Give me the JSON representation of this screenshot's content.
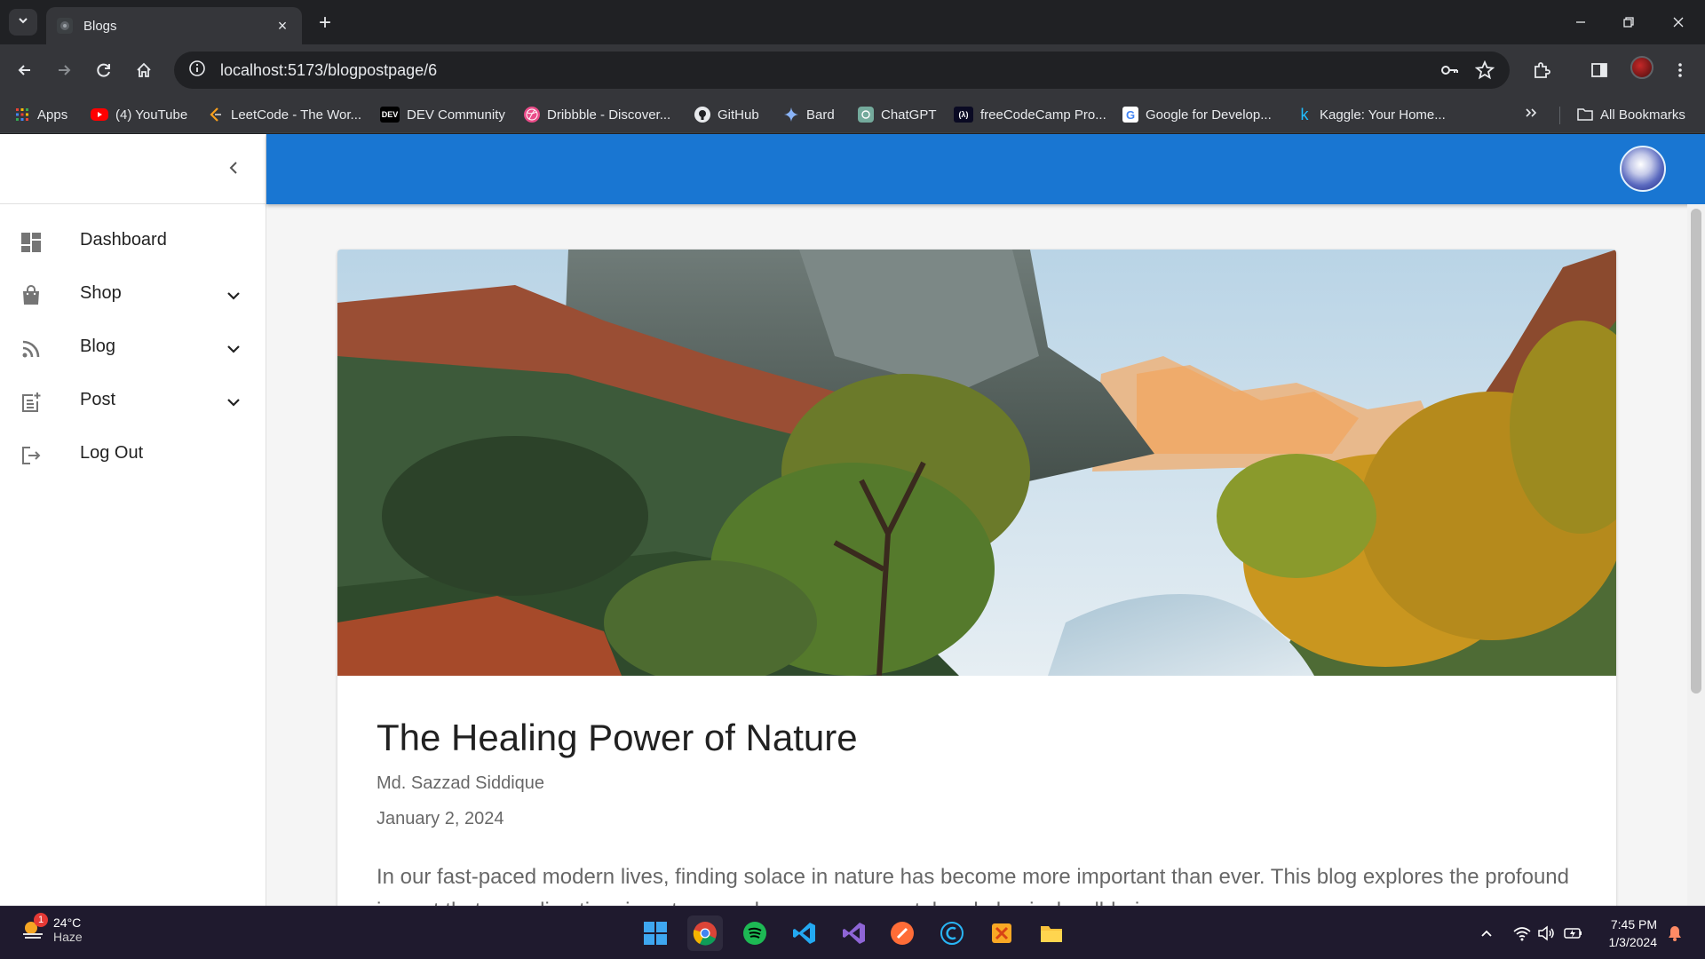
{
  "browser": {
    "tab_title": "Blogs",
    "url": "localhost:5173/blogpostpage/6",
    "bookmarks": [
      {
        "label": "Apps",
        "icon": "apps-grid-icon"
      },
      {
        "label": "(4) YouTube",
        "icon": "youtube-icon"
      },
      {
        "label": "LeetCode - The Wor...",
        "icon": "leetcode-icon"
      },
      {
        "label": "DEV Community",
        "icon": "dev-icon"
      },
      {
        "label": "Dribbble - Discover...",
        "icon": "dribbble-icon"
      },
      {
        "label": "GitHub",
        "icon": "github-icon"
      },
      {
        "label": "Bard",
        "icon": "bard-icon"
      },
      {
        "label": "ChatGPT",
        "icon": "chatgpt-icon"
      },
      {
        "label": "freeCodeCamp Pro...",
        "icon": "freecodecamp-icon"
      },
      {
        "label": "Google for Develop...",
        "icon": "google-icon"
      },
      {
        "label": "Kaggle: Your Home...",
        "icon": "kaggle-icon"
      }
    ],
    "all_bookmarks_label": "All Bookmarks",
    "dev_badge": "DEV",
    "fcc_badge": "(λ)",
    "google_badge": "G",
    "kaggle_badge": "k"
  },
  "sidebar": {
    "items": [
      {
        "label": "Dashboard",
        "icon": "dashboard-icon",
        "expandable": false
      },
      {
        "label": "Shop",
        "icon": "shopping-bag-icon",
        "expandable": true
      },
      {
        "label": "Blog",
        "icon": "rss-feed-icon",
        "expandable": true
      },
      {
        "label": "Post",
        "icon": "post-add-icon",
        "expandable": true
      },
      {
        "label": "Log Out",
        "icon": "logout-icon",
        "expandable": false
      }
    ]
  },
  "post": {
    "title": "The Healing Power of Nature",
    "author": "Md. Sazzad Siddique",
    "date": "January 2, 2024",
    "body": "In our fast-paced modern lives, finding solace in nature has become more important than ever. This blog explores the profound impact that spending time in nature can have on our mental and physical well-being."
  },
  "taskbar": {
    "weather_temp": "24°C",
    "weather_desc": "Haze",
    "weather_badge": "1",
    "time": "7:45 PM",
    "date": "1/3/2024",
    "apps": [
      "windows-start-icon",
      "chrome-icon",
      "spotify-icon",
      "vscode-icon",
      "visual-studio-icon",
      "postman-icon",
      "c-app-icon",
      "figma-like-icon",
      "file-explorer-icon"
    ]
  },
  "colors": {
    "appbar": "#1976d2",
    "browser_dark": "#202124",
    "taskbar": "#1f1a2e"
  }
}
